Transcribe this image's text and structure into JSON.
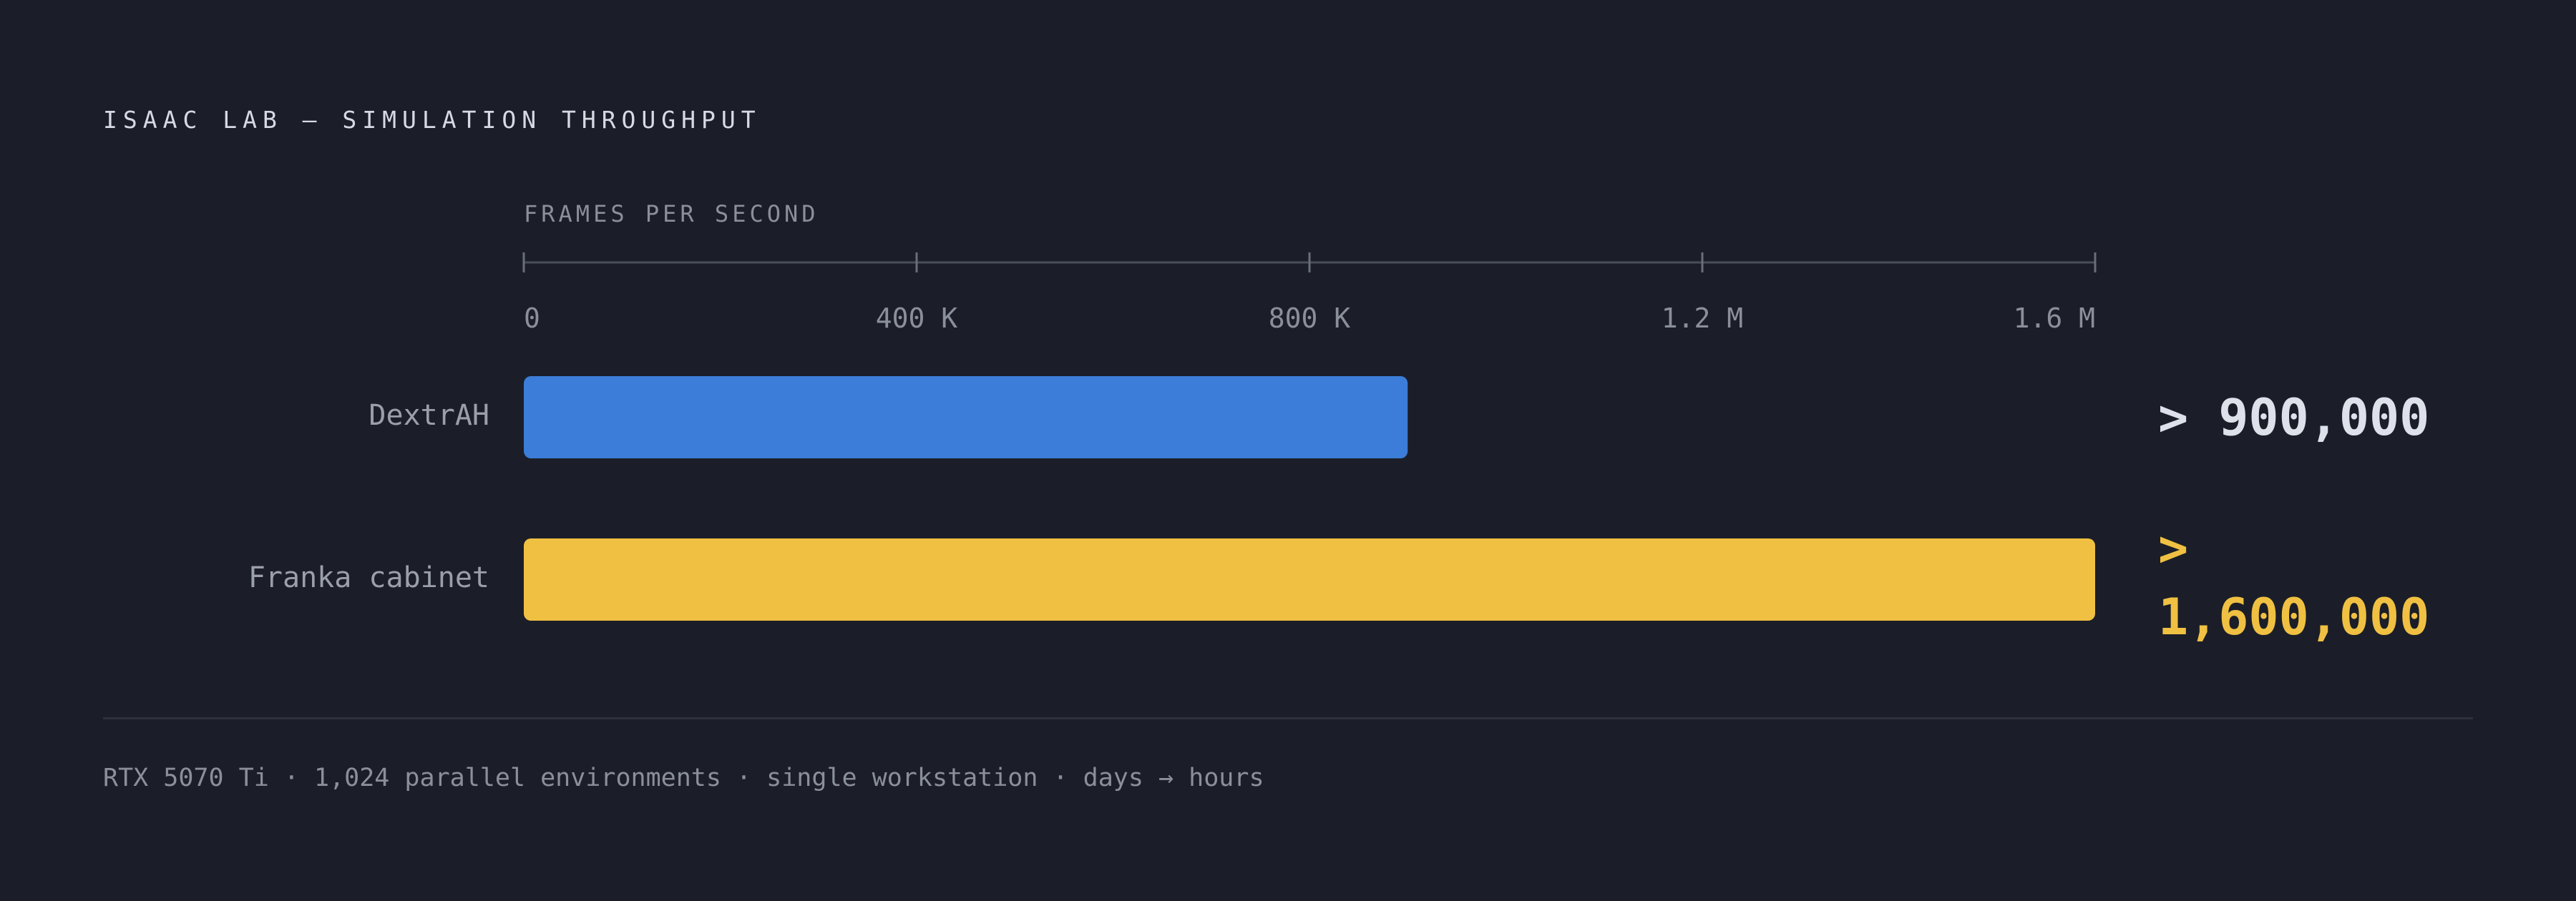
{
  "page": {
    "title": "ISAAC LAB — SIMULATION THROUGHPUT",
    "footer": "RTX 5070 Ti · 1,024 parallel environments · single workstation · days → hours"
  },
  "chart_data": {
    "type": "bar",
    "orientation": "horizontal",
    "title": "",
    "xlabel": "FRAMES PER SECOND",
    "ylabel": "",
    "xlim": [
      0,
      1600000
    ],
    "ticks": [
      {
        "value": 0,
        "label": "0"
      },
      {
        "value": 400000,
        "label": "400 K"
      },
      {
        "value": 800000,
        "label": "800 K"
      },
      {
        "value": 1200000,
        "label": "1.2 M"
      },
      {
        "value": 1600000,
        "label": "1.6 M"
      }
    ],
    "categories": [
      "DextrAH",
      "Franka cabinet"
    ],
    "values": [
      900000,
      1600000
    ],
    "value_labels": [
      "> 900,000",
      "> 1,600,000"
    ],
    "colors": [
      "#3b7dd8",
      "#f0c042"
    ],
    "value_label_colors": [
      "#dde1ea",
      "#f0c042"
    ],
    "grid": false,
    "legend": "none"
  }
}
